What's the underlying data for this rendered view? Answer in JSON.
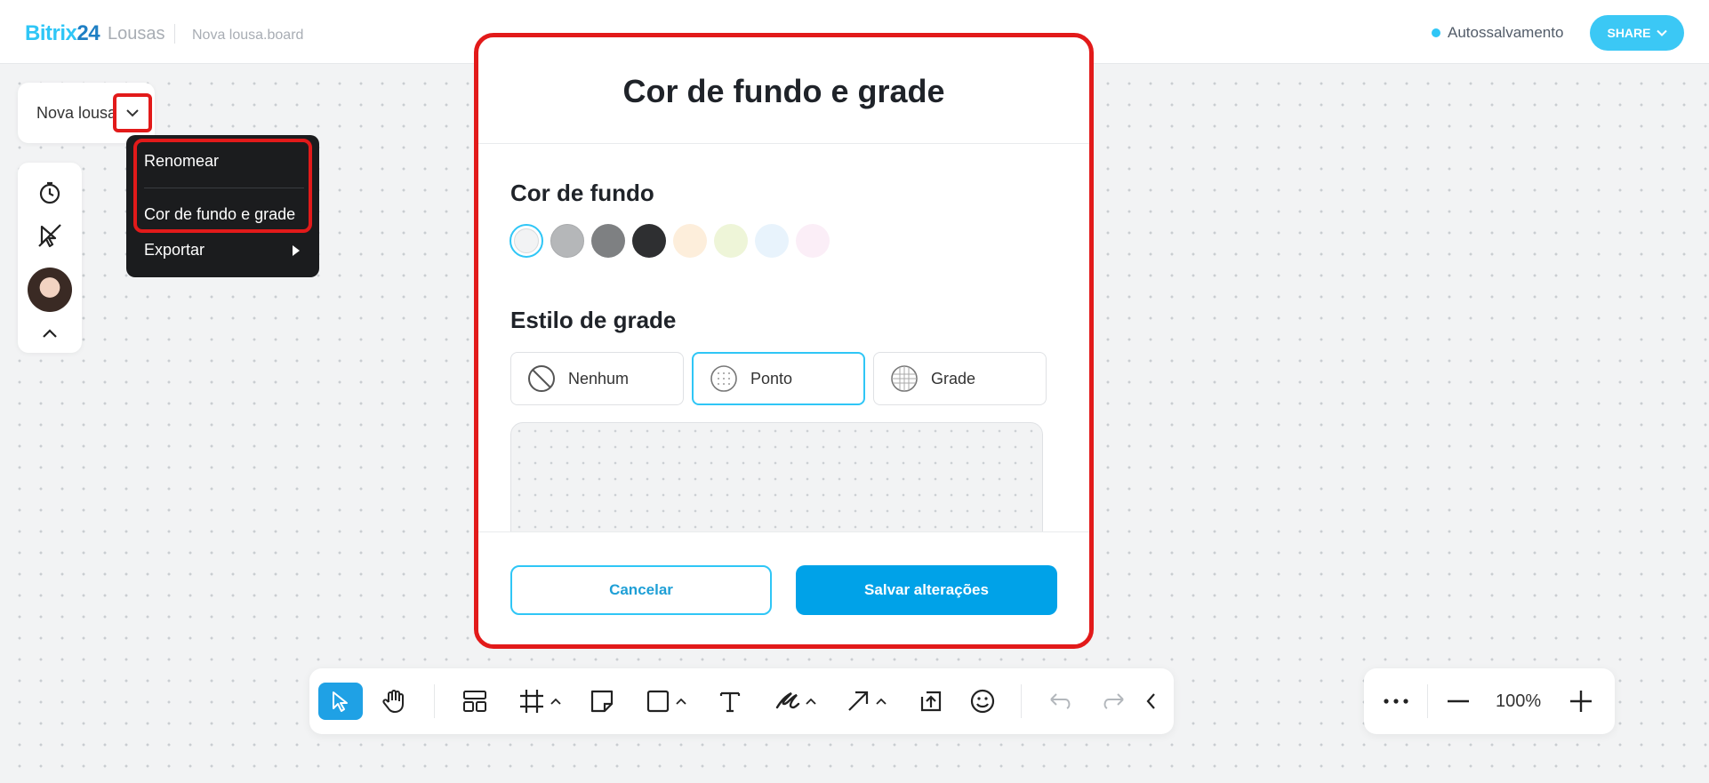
{
  "header": {
    "brand_name": "Bitrix",
    "brand_number": "24",
    "product": "Lousas",
    "document_name": "Nova lousa.board",
    "autosave_label": "Autossalvamento",
    "share_label": "SHARE"
  },
  "board": {
    "title": "Nova lousa"
  },
  "menu": {
    "items": [
      {
        "label": "Renomear"
      },
      {
        "label": "Cor de fundo e grade"
      },
      {
        "label": "Exportar"
      }
    ]
  },
  "modal": {
    "title": "Cor de fundo e grade",
    "background_section": "Cor de fundo",
    "grid_section": "Estilo de grade",
    "colors": [
      "#f2f3f4",
      "#b5b7b9",
      "#7e8082",
      "#2e2f31",
      "#fdeedb",
      "#eef5d8",
      "#e8f3fc",
      "#fbeef7"
    ],
    "selected_color_index": 0,
    "grid_options": [
      {
        "label": "Nenhum",
        "icon": "prohibited-icon"
      },
      {
        "label": "Ponto",
        "icon": "dot-grid-icon"
      },
      {
        "label": "Grade",
        "icon": "line-grid-icon"
      }
    ],
    "selected_grid": "Ponto",
    "cancel_label": "Cancelar",
    "save_label": "Salvar alterações"
  },
  "toolbar": {
    "tools": [
      "select",
      "hand",
      "templates",
      "frame",
      "sticky-note",
      "shape",
      "text",
      "pen",
      "arrow",
      "upload",
      "emoji",
      "undo",
      "redo",
      "collapse"
    ],
    "active_tool": "select"
  },
  "zoom": {
    "value": "100%"
  },
  "colors": {
    "accent": "#2fc6f6",
    "primary_button": "#00a2e8",
    "highlight": "#e21a1a"
  }
}
